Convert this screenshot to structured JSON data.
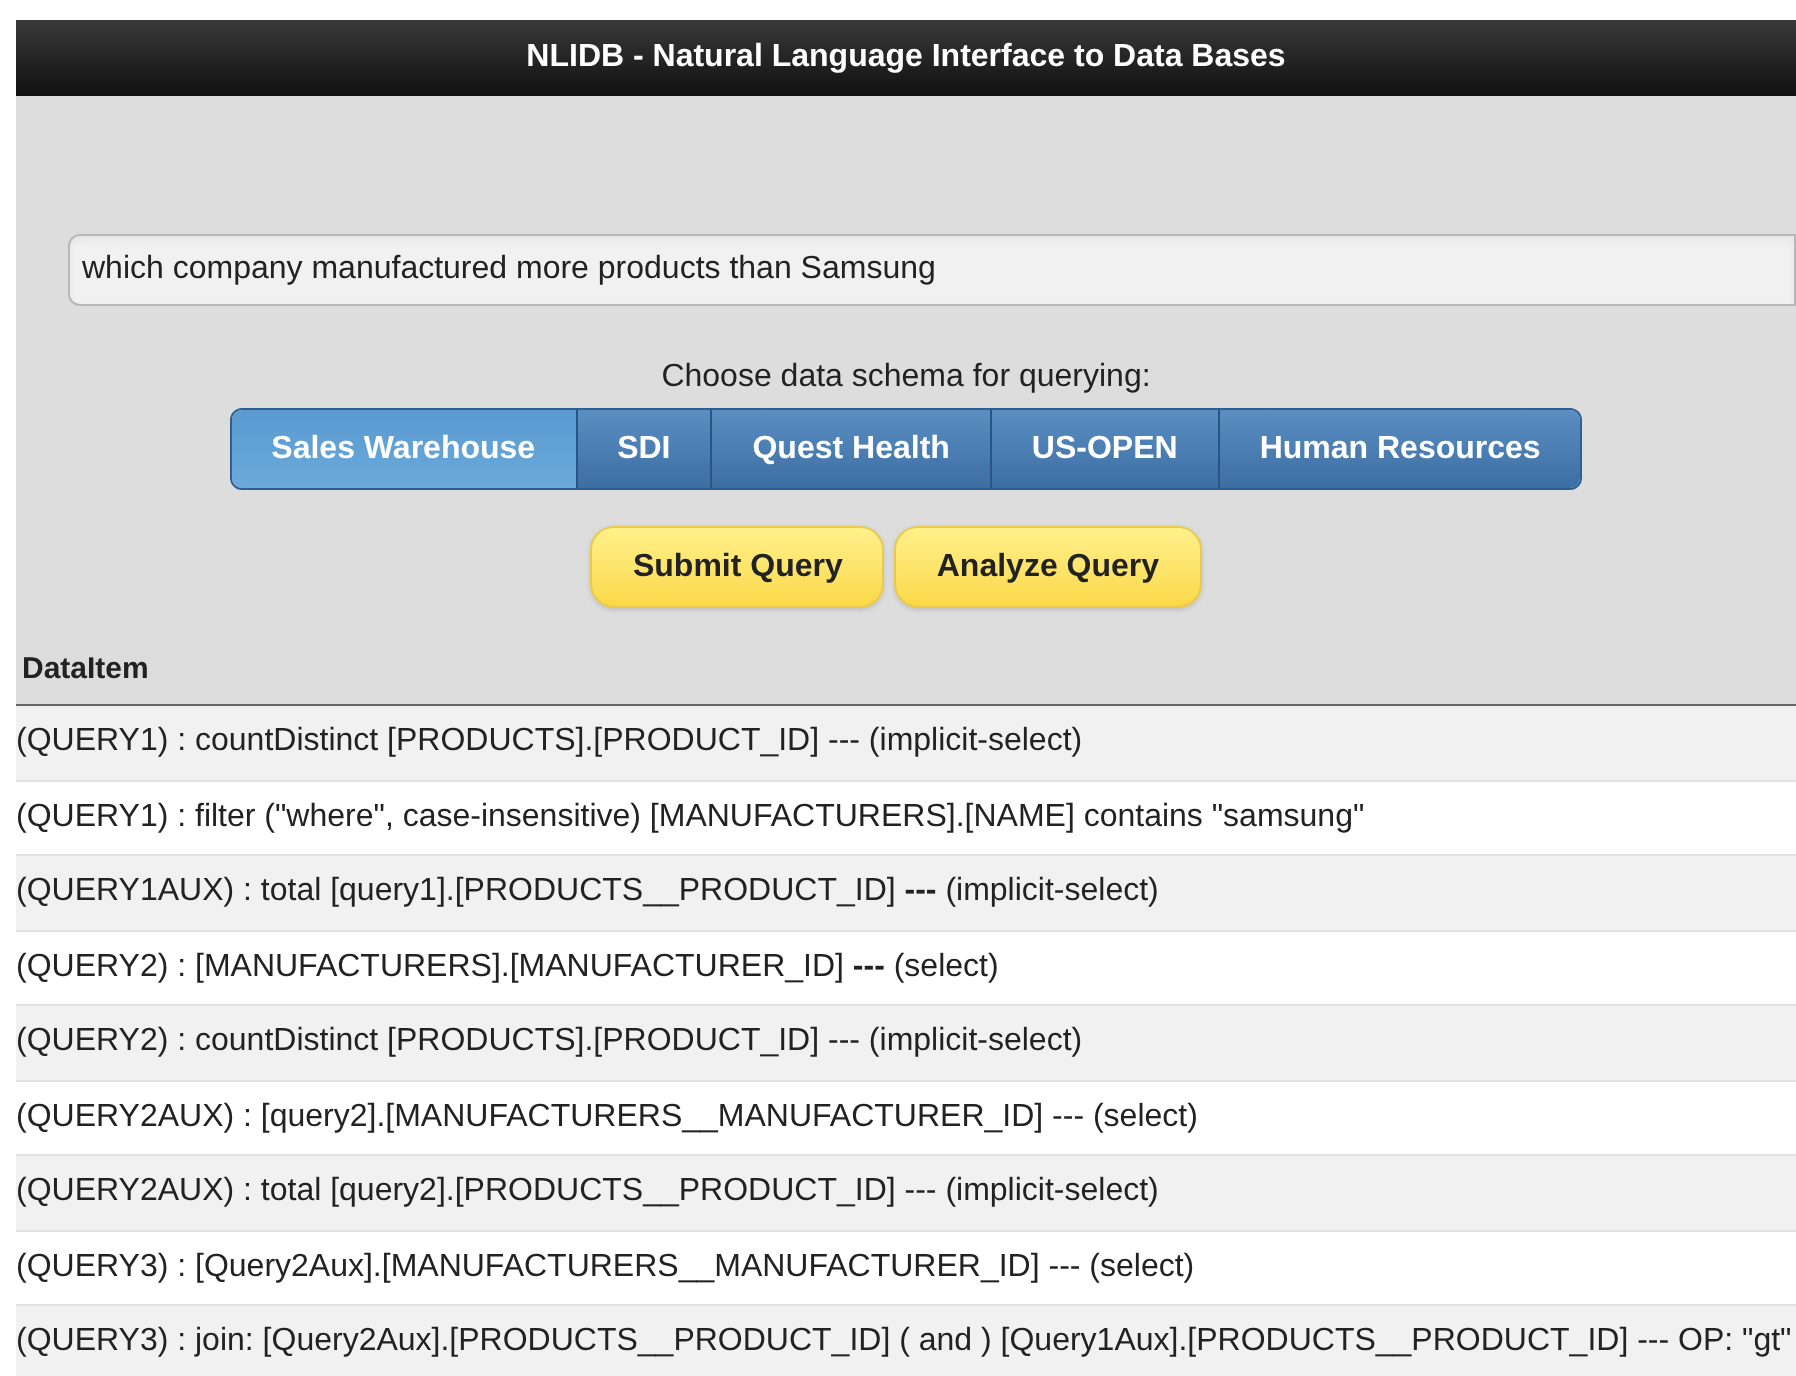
{
  "header": {
    "title": "NLIDB - Natural Language Interface to Data Bases"
  },
  "query_field": {
    "value": "which company manufactured more products than Samsung"
  },
  "schema_label": "Choose data schema for querying:",
  "schema_tabs": [
    {
      "label": "Sales Warehouse",
      "selected": true
    },
    {
      "label": "SDI",
      "selected": false
    },
    {
      "label": "Quest Health",
      "selected": false
    },
    {
      "label": "US-OPEN",
      "selected": false
    },
    {
      "label": "Human Resources",
      "selected": false
    }
  ],
  "buttons": [
    "Submit Query",
    "Analyze Query"
  ],
  "table": {
    "columns": [
      "DataItem"
    ],
    "rows": [
      "(QUERY1) : countDistinct [PRODUCTS].[PRODUCT_ID] --- (implicit-select)",
      "(QUERY1) : filter (\"where\", case-insensitive) [MANUFACTURERS].[NAME] contains \"samsung\"",
      "(QUERY1AUX) : total [query1].[PRODUCTS__PRODUCT_ID] **---** (implicit-select)",
      "(QUERY2) : [MANUFACTURERS].[MANUFACTURER_ID] **---** (select)",
      "(QUERY2) : countDistinct [PRODUCTS].[PRODUCT_ID] --- (implicit-select)",
      "(QUERY2AUX) : [query2].[MANUFACTURERS__MANUFACTURER_ID] --- (select)",
      "(QUERY2AUX) : total [query2].[PRODUCTS__PRODUCT_ID] --- (implicit-select)",
      "(QUERY3) : [Query2Aux].[MANUFACTURERS__MANUFACTURER_ID] --- (select)",
      "(QUERY3) : join: [Query2Aux].[PRODUCTS__PRODUCT_ID] ( and ) [Query1Aux].[PRODUCTS__PRODUCT_ID] --- OP: \"gt\""
    ]
  }
}
